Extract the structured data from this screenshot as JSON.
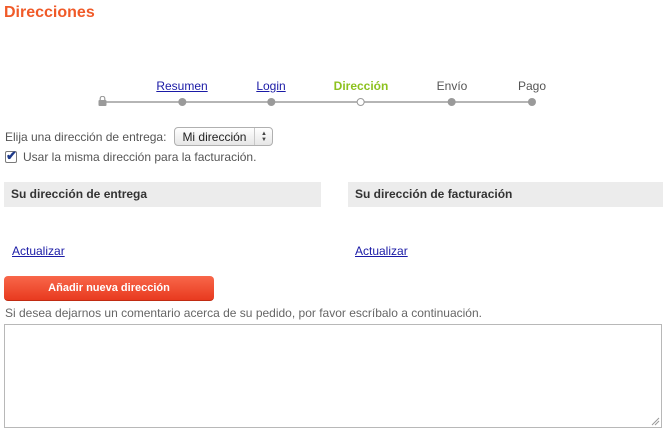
{
  "page": {
    "title": "Direcciones"
  },
  "steps": [
    {
      "label": "Resumen",
      "state": "link"
    },
    {
      "label": "Login",
      "state": "link"
    },
    {
      "label": "Dirección",
      "state": "current"
    },
    {
      "label": "Envío",
      "state": "pending"
    },
    {
      "label": "Pago",
      "state": "pending"
    }
  ],
  "delivery_selector": {
    "label": "Elija una dirección de entrega:",
    "selected": "Mi dirección"
  },
  "same_address": {
    "checked": true,
    "label": "Usar la misma dirección para la facturación."
  },
  "delivery_box": {
    "title": "Su dirección de entrega",
    "update_link": "Actualizar"
  },
  "billing_box": {
    "title": "Su dirección de facturación",
    "update_link": "Actualizar"
  },
  "add_button": {
    "label": "Añadir nueva dirección"
  },
  "comment": {
    "label": "Si desea dejarnos un comentario acerca de su pedido, por favor escríbalo a continuación.",
    "value": ""
  },
  "colors": {
    "title": "#f05a28",
    "current_step": "#8dc21f",
    "link": "#1a1aa6",
    "button": "#e83a1f"
  }
}
